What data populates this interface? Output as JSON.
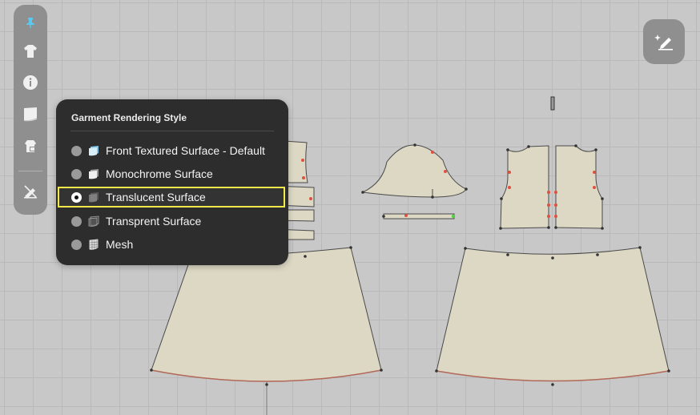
{
  "popup": {
    "title": "Garment Rendering Style",
    "options": [
      {
        "label": "Front Textured Surface - Default",
        "selected": false,
        "icon": "textured-surface-icon"
      },
      {
        "label": "Monochrome Surface",
        "selected": false,
        "icon": "monochrome-surface-icon"
      },
      {
        "label": "Translucent Surface",
        "selected": true,
        "icon": "translucent-surface-icon"
      },
      {
        "label": "Transprent Surface",
        "selected": false,
        "icon": "transparent-surface-icon"
      },
      {
        "label": "Mesh",
        "selected": false,
        "icon": "mesh-icon"
      }
    ]
  },
  "toolbar": {
    "icons": [
      "pin-icon",
      "garment-icon",
      "info-icon",
      "fabric-icon",
      "avatar-lock-icon",
      "hide-pattern-icon"
    ]
  },
  "colors": {
    "canvas_bg": "#c8c8c8",
    "pattern_fill": "#dcd8c4",
    "panel_bg": "#2d2d2d",
    "highlight": "#f1e84a",
    "active_icon": "#5bc8f0"
  }
}
